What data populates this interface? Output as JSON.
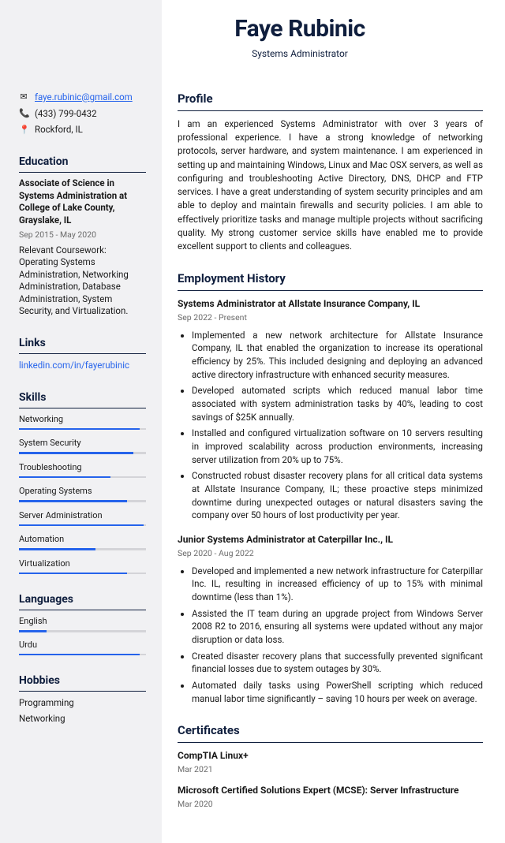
{
  "header": {
    "name": "Faye Rubinic",
    "title": "Systems Administrator"
  },
  "contact": {
    "email": "faye.rubinic@gmail.com",
    "phone": "(433) 799-0432",
    "location": "Rockford, IL"
  },
  "education": {
    "heading": "Education",
    "degree": "Associate of Science in Systems Administration at College of Lake County, Grayslake, IL",
    "dates": "Sep 2015 - May 2020",
    "coursework": "Relevant Coursework: Operating Systems Administration, Networking Administration, Database Administration, System Security, and Virtualization."
  },
  "links": {
    "heading": "Links",
    "linkedin": "linkedin.com/in/fayerubinic"
  },
  "skills": {
    "heading": "Skills",
    "items": [
      {
        "name": "Networking",
        "level": 95
      },
      {
        "name": "System Security",
        "level": 90
      },
      {
        "name": "Troubleshooting",
        "level": 72
      },
      {
        "name": "Operating Systems",
        "level": 85
      },
      {
        "name": "Server Administration",
        "level": 98
      },
      {
        "name": "Automation",
        "level": 60
      },
      {
        "name": "Virtualization",
        "level": 85
      }
    ]
  },
  "languages": {
    "heading": "Languages",
    "items": [
      {
        "name": "English",
        "level": 22
      },
      {
        "name": "Urdu",
        "level": 95
      }
    ]
  },
  "hobbies": {
    "heading": "Hobbies",
    "items": [
      "Programming",
      "Networking"
    ]
  },
  "profile": {
    "heading": "Profile",
    "text": "I am an experienced Systems Administrator with over 3 years of professional experience. I have a strong knowledge of networking protocols, server hardware, and system maintenance. I am experienced in setting up and maintaining Windows, Linux and Mac OSX servers, as well as configuring and troubleshooting Active Directory, DNS, DHCP and FTP services. I have a great understanding of system security principles and am able to deploy and maintain firewalls and security policies. I am able to effectively prioritize tasks and manage multiple projects without sacrificing quality. My strong customer service skills have enabled me to provide excellent support to clients and colleagues."
  },
  "employment": {
    "heading": "Employment History",
    "jobs": [
      {
        "title": "Systems Administrator at Allstate Insurance Company, IL",
        "dates": "Sep 2022 - Present",
        "bullets": [
          "Implemented a new network architecture for Allstate Insurance Company, IL that enabled the organization to increase its operational efficiency by 25%. This included designing and deploying an advanced active directory infrastructure with enhanced security measures.",
          "Developed automated scripts which reduced manual labor time associated with system administration tasks by 40%, leading to cost savings of $25K annually.",
          "Installed and configured virtualization software on 10 servers resulting in improved scalability across production environments, increasing server utilization from 20% up to 75%.",
          "Constructed robust disaster recovery plans for all critical data systems at Allstate Insurance Company, IL; these proactive steps minimized downtime during unexpected outages or natural disasters saving the company over 50 hours of lost productivity per year."
        ]
      },
      {
        "title": "Junior Systems Administrator at Caterpillar Inc., IL",
        "dates": "Sep 2020 - Aug 2022",
        "bullets": [
          "Developed and implemented a new network infrastructure for Caterpillar Inc. IL, resulting in increased efficiency of up to 15% with minimal downtime (less than 1%).",
          "Assisted the IT team during an upgrade project from Windows Server 2008 R2 to 2016, ensuring all systems were updated without any major disruption or data loss.",
          "Created disaster recovery plans that successfully prevented significant financial losses due to system outages by 30%.",
          "Automated daily tasks using PowerShell scripting which reduced manual labor time significantly – saving 10 hours per week on average."
        ]
      }
    ]
  },
  "certificates": {
    "heading": "Certificates",
    "items": [
      {
        "name": "CompTIA Linux+",
        "date": "Mar 2021"
      },
      {
        "name": "Microsoft Certified Solutions Expert (MCSE): Server Infrastructure",
        "date": "Mar 2020"
      }
    ]
  }
}
